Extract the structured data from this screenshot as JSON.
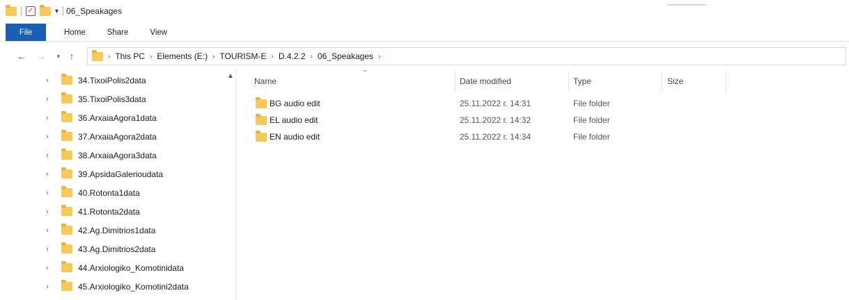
{
  "window": {
    "title": "06_Speakages"
  },
  "ribbon": {
    "tabs": [
      "File",
      "Home",
      "Share",
      "View"
    ]
  },
  "address_bar": {
    "crumbs": [
      "This PC",
      "Elements (E:)",
      "TOURISM-E",
      "D.4.2.2",
      "06_Speakages"
    ]
  },
  "nav_pane": {
    "items": [
      "34.TixoiPolis2data",
      "35.TixoiPolis3data",
      "36.ArxaiaAgora1data",
      "37.ArxaiaAgora2data",
      "38.ArxaiaAgora3data",
      "39.ApsidaGalerioudata",
      "40.Rotonta1data",
      "41.Rotonta2data",
      "42.Ag.Dimitrios1data",
      "43.Ag.Dimitrios2data",
      "44.Arxiologiko_Komotinidata",
      "45.Arxiologiko_Komotini2data"
    ]
  },
  "content": {
    "columns": {
      "name": "Name",
      "date_modified": "Date modified",
      "type": "Type",
      "size": "Size"
    },
    "files": [
      {
        "name": "BG audio edit",
        "date": "25.11.2022 г. 14:31",
        "type": "File folder"
      },
      {
        "name": "EL audio edit",
        "date": "25.11.2022 г. 14:32",
        "type": "File folder"
      },
      {
        "name": "EN audio edit",
        "date": "25.11.2022 г. 14:34",
        "type": "File folder"
      }
    ]
  },
  "colors": {
    "accent": "#1a5fb4",
    "folder": "#f6c95a"
  }
}
